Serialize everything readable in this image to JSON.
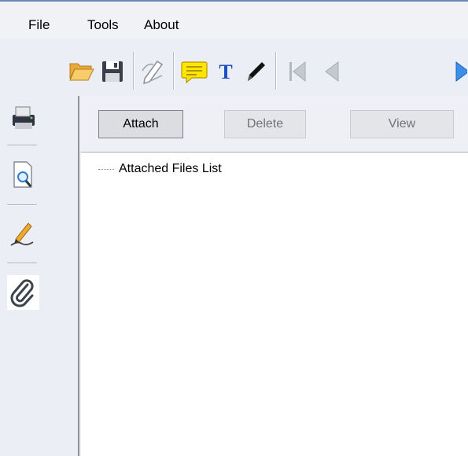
{
  "menu": {
    "file": "File",
    "tools": "Tools",
    "about": "About"
  },
  "toolbar": {
    "icons": [
      "open-folder-icon",
      "save-icon",
      "edit-pen-icon",
      "comment-icon",
      "text-icon",
      "pencil-icon",
      "first-page-icon",
      "previous-page-icon",
      "next-page-icon"
    ],
    "colors": {
      "folder": "#f1c25a",
      "comment": "#ffe600",
      "text": "#1d4fc2",
      "nav_next": "#3b8fe8"
    }
  },
  "sidebar": {
    "icons": [
      "printer-icon",
      "print-preview-icon",
      "signature-icon",
      "attachment-icon"
    ],
    "active": "attachment-icon"
  },
  "attachments": {
    "attach_label": "Attach",
    "delete_label": "Delete",
    "view_label": "View",
    "tree_root": "Attached Files List"
  }
}
